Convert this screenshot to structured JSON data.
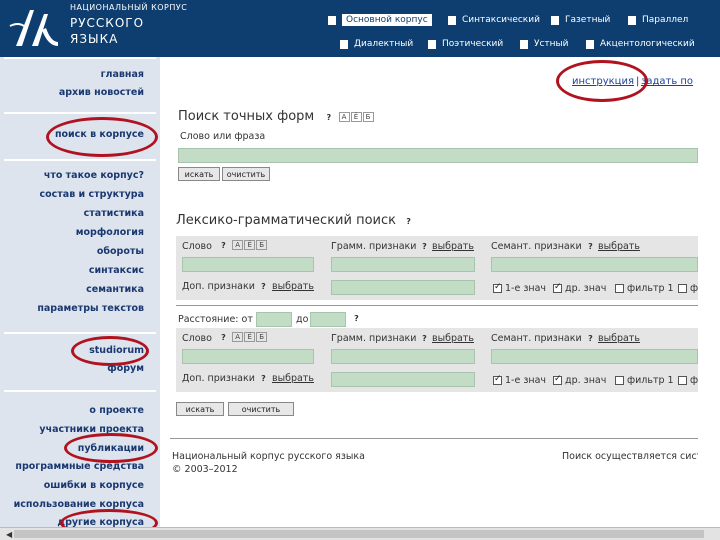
{
  "header": {
    "logo_line1": "НАЦИОНАЛЬНЫЙ КОРПУС",
    "logo_line2": "РУССКОГО",
    "logo_line3": "ЯЗЫКА",
    "corpora_row1": [
      "Основной корпус",
      "Синтаксический",
      "Газетный",
      "Параллел"
    ],
    "corpora_row2": [
      "Диалектный",
      "Поэтический",
      "Устный",
      "Акцентологический"
    ]
  },
  "nav": {
    "group1": [
      "главная",
      "архив новостей"
    ],
    "group2": [
      "поиск в корпусе"
    ],
    "group3": [
      "что такое корпус?",
      "состав и структура",
      "статистика",
      "морфология",
      "обороты",
      "синтаксис",
      "семантика",
      "параметры текстов"
    ],
    "group4": [
      "studiorum",
      "форум"
    ],
    "group5": [
      "о проекте",
      "участники проекта",
      "публикации",
      "программные средства",
      "ошибки в корпусе",
      "использование корпуса",
      "другие корпуса"
    ]
  },
  "top_links": {
    "instruction": "инструкция",
    "ask": "задать по"
  },
  "exact_search": {
    "title": "Поиск точных форм",
    "badges": [
      "А",
      "Ё",
      "Б"
    ],
    "field_label": "Слово или фраза",
    "search_btn": "искать",
    "clear_btn": "очистить"
  },
  "lexgram": {
    "title": "Лексико-грамматический поиск",
    "word_label": "Слово",
    "gram_label": "Грамм. признаки",
    "sem_label": "Семант. признаки",
    "choose": "выбрать",
    "extra_label": "Доп. признаки",
    "check1": "1-е знач",
    "check2": "др. знач",
    "check3": "фильтр 1",
    "check4": "ф",
    "distance_label": "Расстояние: от",
    "distance_to": "до",
    "search_btn": "искать",
    "clear_btn": "очистить"
  },
  "footer": {
    "line1": "Национальный корпус русского языка",
    "line2": "© 2003–2012",
    "right": "Поиск осуществляется сист"
  },
  "colors": {
    "header_bg": "#0d3e6f",
    "field_bg": "#c3dcc6",
    "nav_bg": "#dde4ee",
    "annotation": "#b0131f"
  }
}
